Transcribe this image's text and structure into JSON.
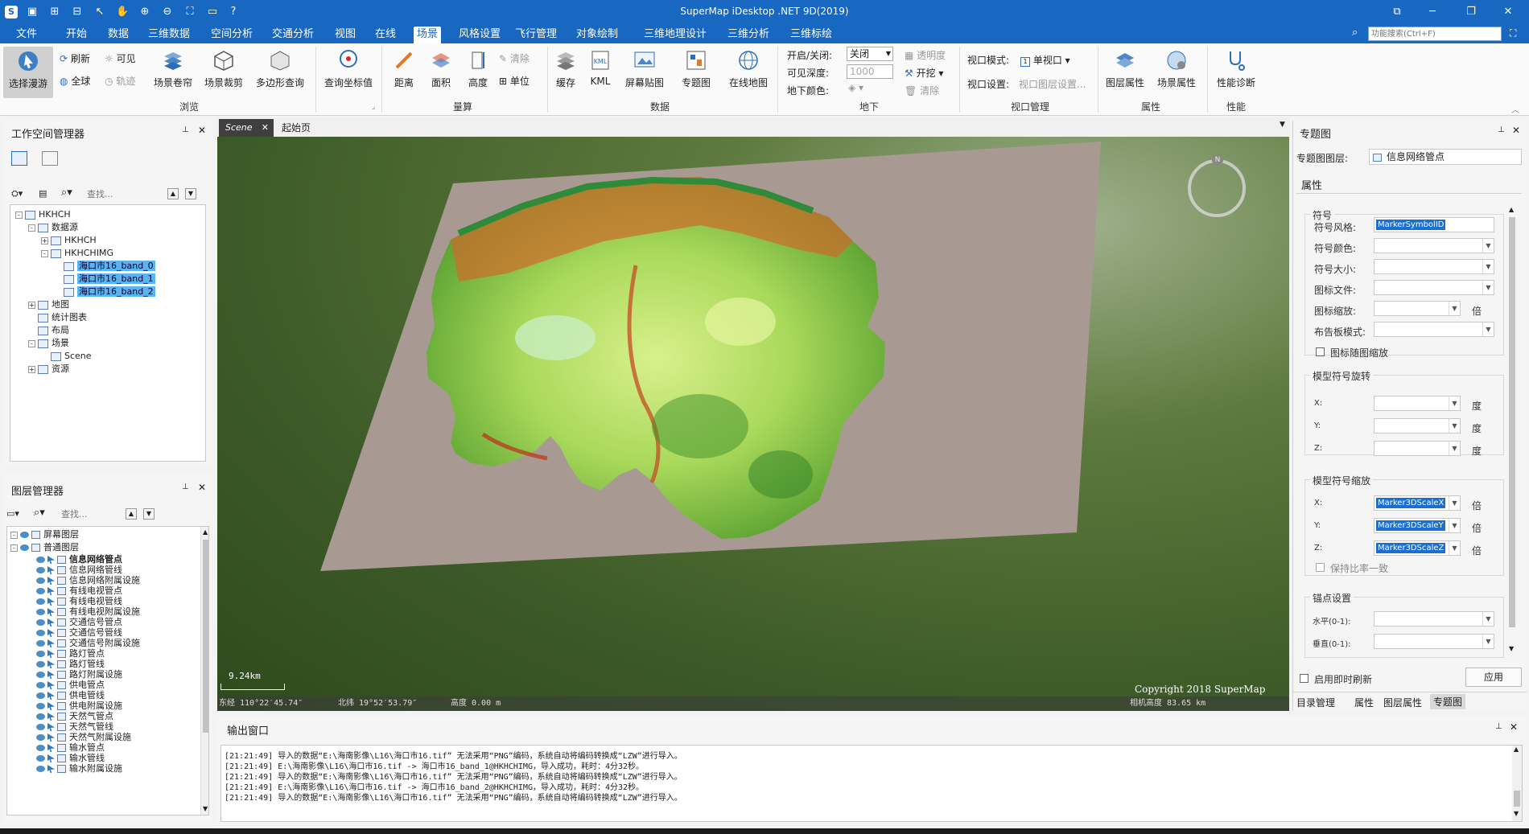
{
  "app": {
    "title": "SuperMap iDesktop .NET 9D(2019)"
  },
  "menu": [
    "文件",
    "开始",
    "数据",
    "三维数据",
    "空间分析",
    "交通分析",
    "视图",
    "在线",
    "场景",
    "风格设置",
    "飞行管理",
    "对象绘制",
    "三维地理设计",
    "三维分析",
    "三维标绘"
  ],
  "menu_active": "场景",
  "search": {
    "placeholder": "功能搜索(Ctrl+F)"
  },
  "ribbon": {
    "browse": {
      "select": "选择漫游",
      "refresh": "刷新",
      "visible": "可见",
      "full": "全球",
      "track": "轨迹",
      "scroll": "场景卷帘",
      "clip": "场景裁剪",
      "poly": "多边形查询",
      "coord": "查询坐标值",
      "label": "浏览"
    },
    "measure": {
      "dist": "距离",
      "area": "面积",
      "height": "高度",
      "clear": "清除",
      "unit": "单位",
      "label": "量算"
    },
    "data": {
      "cache": "缓存",
      "kml": "KML",
      "screen": "屏幕贴图",
      "thematic": "专题图",
      "online": "在线地图",
      "label": "数据"
    },
    "underground": {
      "onoff_label": "开启/关闭:",
      "onoff_value": "关闭",
      "depth_label": "可见深度:",
      "depth_value": "1000",
      "color_label": "地下颜色:",
      "transp": "透明度",
      "dig": "开挖",
      "clear": "清除",
      "label": "地下"
    },
    "viewport": {
      "mode_label": "视口模式:",
      "mode_value": "单视口",
      "set_label": "视口设置:",
      "set_value": "视口图层设置...",
      "label": "视口管理"
    },
    "props": {
      "layer": "图层属性",
      "scene": "场景属性",
      "label": "属性"
    },
    "perf": {
      "diag": "性能诊断",
      "label": "性能"
    }
  },
  "workspace": {
    "title": "工作空间管理器",
    "search_placeholder": "查找...",
    "tree": [
      {
        "label": "HKHCH",
        "level": 0,
        "toggle": "-"
      },
      {
        "label": "数据源",
        "level": 1,
        "toggle": "-"
      },
      {
        "label": "HKHCH",
        "level": 2,
        "toggle": "+"
      },
      {
        "label": "HKHCHIMG",
        "level": 2,
        "toggle": "-"
      },
      {
        "label": "海口市16_band_0",
        "level": 3,
        "toggle": "",
        "selected": true
      },
      {
        "label": "海口市16_band_1",
        "level": 3,
        "toggle": "",
        "selected": true
      },
      {
        "label": "海口市16_band_2",
        "level": 3,
        "toggle": "",
        "selected": true
      },
      {
        "label": "地图",
        "level": 1,
        "toggle": "+"
      },
      {
        "label": "统计图表",
        "level": 1,
        "toggle": ""
      },
      {
        "label": "布局",
        "level": 1,
        "toggle": ""
      },
      {
        "label": "场景",
        "level": 1,
        "toggle": "-"
      },
      {
        "label": "Scene",
        "level": 2,
        "toggle": ""
      },
      {
        "label": "资源",
        "level": 1,
        "toggle": "+"
      }
    ]
  },
  "layers": {
    "title": "图层管理器",
    "search_placeholder": "查找...",
    "groups": [
      "屏幕图层",
      "普通图层"
    ],
    "items": [
      "信息网络管点",
      "信息网络管线",
      "信息网络附属设施",
      "有线电视管点",
      "有线电视管线",
      "有线电视附属设施",
      "交通信号管点",
      "交通信号管线",
      "交通信号附属设施",
      "路灯管点",
      "路灯管线",
      "路灯附属设施",
      "供电管点",
      "供电管线",
      "供电附属设施",
      "天然气管点",
      "天然气管线",
      "天然气附属设施",
      "输水管点",
      "输水管线",
      "输水附属设施"
    ]
  },
  "tabs": {
    "scene": "Scene",
    "start": "起始页"
  },
  "scene": {
    "scale": "9.24km",
    "status_lon": "东经 110°22′45.74″",
    "status_lat": "北纬 19°52′53.79″",
    "status_alt": "高度 0.00 m",
    "camera": "相机高度 83.65 km",
    "copyright": "Copyright 2018 SuperMap",
    "compass": "N"
  },
  "thematic": {
    "title": "专题图",
    "layer_label": "专题图图层:",
    "layer_value": "信息网络管点",
    "prop_tab": "属性",
    "symbol_group": "符号",
    "fields": {
      "style": "符号风格:",
      "color": "符号颜色:",
      "size": "符号大小:",
      "icon": "图标文件:",
      "icon_scale": "图标缩放:",
      "billboard": "布告板模式:",
      "icon_follow": "图标随图缩放"
    },
    "style_value": "MarkerSymbolID",
    "rot_group": "模型符号旋转",
    "scale_group": "模型符号缩放",
    "x": "X:",
    "y": "Y:",
    "z": "Z:",
    "deg": "度",
    "bei": "倍",
    "scale_x": "Marker3DScaleX",
    "scale_y": "Marker3DScaleY",
    "scale_z": "Marker3DScaleZ",
    "keep_ratio": "保持比率一致",
    "anchor_group": "锚点设置",
    "h": "水平(0-1):",
    "v": "垂直(0-1):",
    "instant": "启用即时刷新",
    "apply": "应用",
    "bottom_tabs": [
      "目录管理",
      "属性",
      "图层属性",
      "专题图"
    ]
  },
  "output": {
    "title": "输出窗口",
    "lines": [
      "[21:21:49] 导入的数据“E:\\海南影像\\L16\\海口市16.tif” 无法采用“PNG”编码，系统自动将编码转换成“LZW”进行导入。",
      "[21:21:49] E:\\海南影像\\L16\\海口市16.tif    -> 海口市16_band_1@HKHCHIMG，导入成功，耗时：4分32秒。",
      "[21:21:49] 导入的数据“E:\\海南影像\\L16\\海口市16.tif” 无法采用“PNG”编码，系统自动将编码转换成“LZW”进行导入。",
      "[21:21:49] E:\\海南影像\\L16\\海口市16.tif    -> 海口市16_band_2@HKHCHIMG，导入成功，耗时：4分32秒。",
      "[21:21:49] 导入的数据“E:\\海南影像\\L16\\海口市16.tif” 无法采用“PNG”编码，系统自动将编码转换成“LZW”进行导入。"
    ]
  },
  "colors": {
    "brand": "#1867c0",
    "selection": "#5bb3f0",
    "terrain_base": "#a89a92"
  }
}
